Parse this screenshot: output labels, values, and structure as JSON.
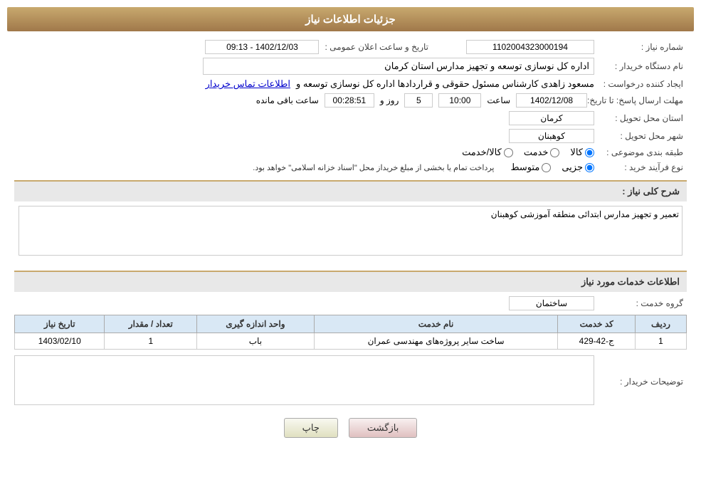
{
  "header": {
    "title": "جزئیات اطلاعات نیاز"
  },
  "fields": {
    "shomareNiaz_label": "شماره نیاز :",
    "shomareNiaz_value": "1102004323000194",
    "namDastgah_label": "نام دستگاه خریدار :",
    "namDastgah_value": "اداره کل نوسازی  توسعه و تجهیز مدارس استان کرمان",
    "ijadKonande_label": "ایجاد کننده درخواست :",
    "ijadKonande_value": "مسعود زاهدی کارشناس مسئول حقوقی و قراردادها اداره کل نوسازی  توسعه  و",
    "ettelaat_link": "اطلاعات تماس خریدار",
    "tarikhErsal_label": "مهلت ارسال پاسخ: تا تاریخ:",
    "tarikhErsal_date": "1402/12/08",
    "tarikhErsal_saat": "10:00",
    "tarikhErsal_roz": "5",
    "tarikhErsal_baqi": "00:28:51",
    "tarikhErsal_text": "روز و",
    "tarikhErsal_saatText": "ساعت باقی مانده",
    "tarikhVaSaat_label": "تاریخ و ساعت اعلان عمومی :",
    "tarikhVaSaat_value": "1402/12/03 - 09:13",
    "ostan_label": "استان محل تحویل :",
    "ostan_value": "کرمان",
    "shahr_label": "شهر محل تحویل :",
    "shahr_value": "کوهبنان",
    "tabaqeBandi_label": "طبقه بندی موضوعی :",
    "tabaqeBandi_kala": "کالا",
    "tabaqeBandi_khadamat": "خدمت",
    "tabaqeBandi_kalaKhadamat": "کالا/خدمت",
    "noeFarayand_label": "نوع فرآیند خرید :",
    "noeFarayand_jozei": "جزیی",
    "noeFarayand_motovaset": "متوسط",
    "noeFarayand_note": "پرداخت تمام یا بخشی از مبلغ خریداز محل \"اسناد خزانه اسلامی\" خواهد بود.",
    "sharhKoli_label": "شرح کلی نیاز :",
    "sharhKoli_value": "تعمیر و تجهیز مدارس ابتدائی منطقه آموزشی کوهبنان",
    "khadamatSection_title": "اطلاعات خدمات مورد نیاز",
    "groheKhadamat_label": "گروه خدمت :",
    "groheKhadamat_value": "ساختمان",
    "table": {
      "headers": [
        "ردیف",
        "کد خدمت",
        "نام خدمت",
        "واحد اندازه گیری",
        "تعداد / مقدار",
        "تاریخ نیاز"
      ],
      "rows": [
        {
          "radif": "1",
          "kodKhadamat": "ج-42-429",
          "namKhadamat": "ساخت سایر پروژه‌های مهندسی عمران",
          "vahed": "باب",
          "tedad": "1",
          "tarikh": "1403/02/10"
        }
      ]
    },
    "tosifat_label": "توضیحات خریدار :",
    "btn_print": "چاپ",
    "btn_back": "بازگشت"
  }
}
